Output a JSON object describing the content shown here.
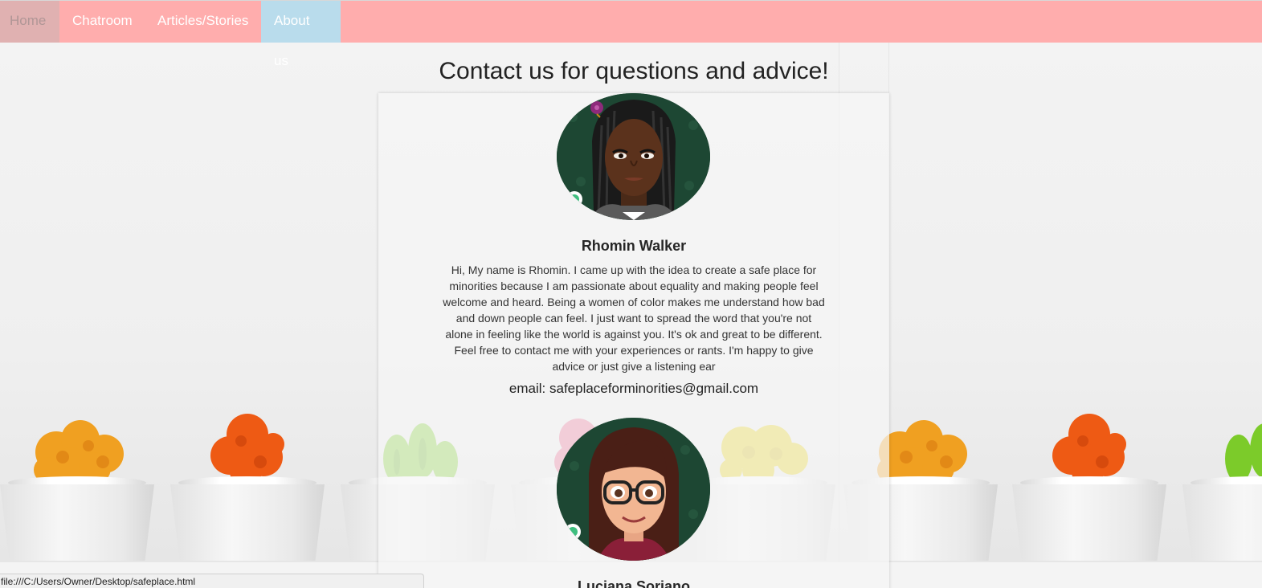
{
  "nav": {
    "items": [
      {
        "label": "Home"
      },
      {
        "label": "Chatroom"
      },
      {
        "label": "Articles/Stories"
      },
      {
        "label": "About us"
      }
    ]
  },
  "main": {
    "title": "Contact us for questions and advice!",
    "members": [
      {
        "name": "Rhomin Walker",
        "bio": "Hi, My name is Rhomin. I came up with the idea to create a safe place for minorities because I am passionate about equality and making people feel welcome and heard. Being a women of color makes me understand how bad and down people can feel. I just want to spread the word that you're not alone in feeling like the world is against you. It's ok and great to be different. Feel free to contact me with your experiences or rants. I'm happy to give advice or just give a listening ear",
        "email": "email: safeplaceforminorities@gmail.com"
      },
      {
        "name": "Luciana Soriano"
      }
    ]
  },
  "status_bar": {
    "url": "file:///C:/Users/Owner/Desktop/safeplace.html"
  },
  "colors": {
    "navbar": "#ffadad",
    "nav_home": "#e0b1b1",
    "nav_active": "#b9dcec"
  }
}
